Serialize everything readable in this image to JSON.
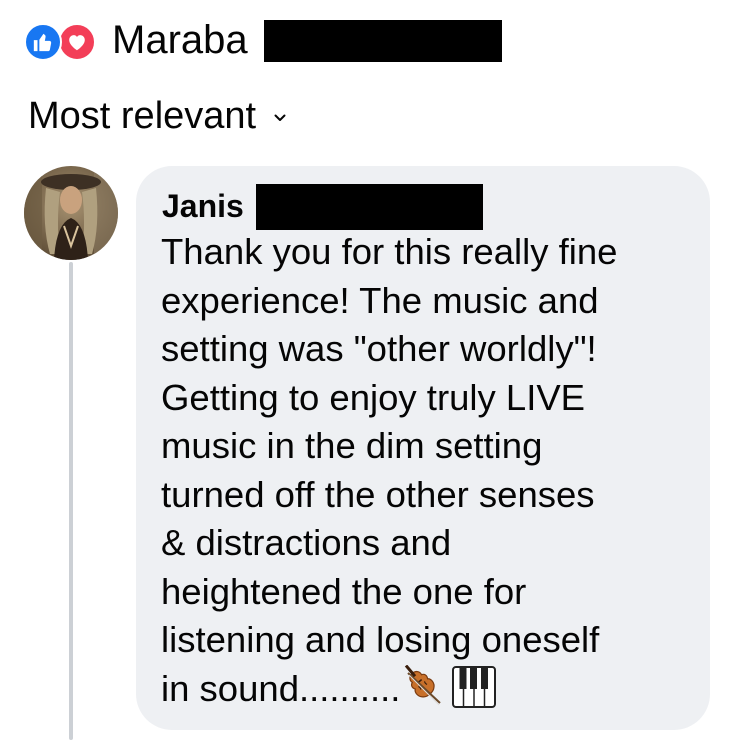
{
  "reactions": {
    "types": [
      "like",
      "love"
    ],
    "reactor_name": "Maraba"
  },
  "sort": {
    "label": "Most relevant"
  },
  "comment": {
    "author": "Janis",
    "lines": [
      "Thank you for this really fine",
      "experience! The music and",
      "setting was \"other worldly\"!",
      "Getting to enjoy truly LIVE",
      "music in the dim setting",
      "turned off the other senses",
      "& distractions and",
      "heightened the one for",
      "listening and losing oneself",
      "in sound.........."
    ],
    "emojis": [
      "violin-icon",
      "piano-keys-icon"
    ]
  },
  "colors": {
    "like_blue": "#1877f2",
    "love_red": "#f33e58",
    "bubble_bg": "#eef0f3",
    "thread_line": "#ccd0d5"
  }
}
